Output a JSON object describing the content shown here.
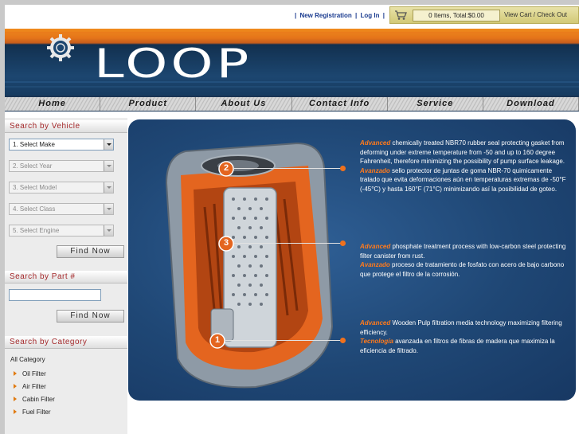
{
  "top_links": {
    "new_registration": "New Registration",
    "login": "Log In"
  },
  "cart": {
    "items_total": "0 Items, Total:$0.00",
    "view_cart": "View Cart / Check Out"
  },
  "brand": {
    "name": "LOOP",
    "accent": "#f08b1c",
    "navy": "#1c4670"
  },
  "nav": [
    "Home",
    "Product",
    "About Us",
    "Contact Info",
    "Service",
    "Download"
  ],
  "sidebar": {
    "vehicle_heading": "Search by Vehicle",
    "selects": [
      {
        "label": "1. Select Make",
        "enabled": true
      },
      {
        "label": "2. Select Year",
        "enabled": false
      },
      {
        "label": "3. Select Model",
        "enabled": false
      },
      {
        "label": "4. Select Class",
        "enabled": false
      },
      {
        "label": "5. Select Engine",
        "enabled": false
      }
    ],
    "find_now": "Find Now",
    "part_heading": "Search by Part  #",
    "part_input_value": "",
    "find_now_2": "Find Now",
    "category_heading": "Search by Category",
    "all_category": "All Category",
    "categories": [
      "Oil Filter",
      "Air Filter",
      "Cabin Filter",
      "Fuel Filter"
    ]
  },
  "hero": {
    "callouts": [
      {
        "number": "2",
        "en_hl": "Advanced",
        "en": " chemically treated NBR70 rubber seal protecting gasket from deforming under extreme temperature from -50 and up to 160 degree Fahrenheit, therefore minimizing the possibility of pump surface leakage.",
        "es_hl": "Avanzado",
        "es": " sello protector de juntas de goma NBR-70 quimicamente tratado que evita deformaciones aún en temperaturas extremas de -50°F (-45°C) y hasta 160°F (71°C) minimizando así la posibilidad de goteo."
      },
      {
        "number": "3",
        "en_hl": "Advanced",
        "en": " phosphate treatment process with low-carbon steel protecting filter canister from rust.",
        "es_hl": "Avanzado",
        "es": " proceso de tratamiento de fosfato con acero de bajo carbono que protege el filtro de la corrosión."
      },
      {
        "number": "1",
        "en_hl": "Advanced",
        "en": " Wooden Pulp filtration media technology maximizing filtering efficiency.",
        "es_hl": "Tecnología",
        "es": " avanzada en filtros de fibras de madera que maximiza la eficiencia de filtrado."
      }
    ]
  }
}
